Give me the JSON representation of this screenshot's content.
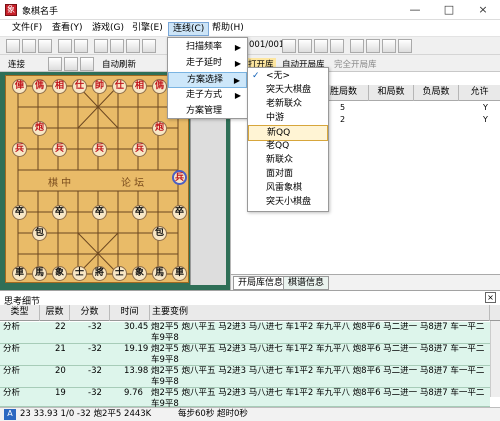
{
  "window": {
    "title": "象棋名手"
  },
  "menu": [
    "文件(F)",
    "查看(Y)",
    "游戏(G)",
    "引擎(E)",
    "连线(C)",
    "帮助(H)"
  ],
  "toolbar": {
    "page": "001/001",
    "connect_label": "连接",
    "auto_refresh": "自动刷新",
    "open_library": "打开库",
    "auto_open_library": "自动开局库",
    "full_open_library": "完全开局库"
  },
  "dropdown_main": [
    "扫描频率",
    "走子延时",
    "方案选择",
    "走子方式",
    "方案管理"
  ],
  "dropdown_sub": [
    "<无>",
    "突天大棋盘",
    "老新联众",
    "中游",
    "新QQ",
    "老QQ",
    "新联众",
    "面对面",
    "风雷象棋",
    "突天小棋盘"
  ],
  "selected_scheme": "新QQ",
  "board": {
    "center_text_left": "棋 中",
    "center_text_right": "论 坛",
    "pieces": [
      {
        "ch": "俥",
        "side": "red"
      },
      {
        "ch": "傌",
        "side": "red"
      },
      {
        "ch": "相",
        "side": "red"
      },
      {
        "ch": "仕",
        "side": "red"
      },
      {
        "ch": "帥",
        "side": "red"
      },
      {
        "ch": "仕",
        "side": "red"
      },
      {
        "ch": "相",
        "side": "red"
      },
      {
        "ch": "傌",
        "side": "red"
      },
      {
        "ch": "俥",
        "side": "red"
      },
      {
        "ch": "炮",
        "side": "red"
      },
      {
        "ch": "炮",
        "side": "red"
      },
      {
        "ch": "兵",
        "side": "red"
      },
      {
        "ch": "兵",
        "side": "red"
      },
      {
        "ch": "兵",
        "side": "red"
      },
      {
        "ch": "兵",
        "side": "red"
      },
      {
        "ch": "兵",
        "side": "red"
      },
      {
        "ch": "卒",
        "side": "black"
      },
      {
        "ch": "卒",
        "side": "black"
      },
      {
        "ch": "卒",
        "side": "black"
      },
      {
        "ch": "卒",
        "side": "black"
      },
      {
        "ch": "卒",
        "side": "black"
      },
      {
        "ch": "包",
        "side": "black"
      },
      {
        "ch": "包",
        "side": "black"
      },
      {
        "ch": "車",
        "side": "black"
      },
      {
        "ch": "馬",
        "side": "black"
      },
      {
        "ch": "象",
        "side": "black"
      },
      {
        "ch": "士",
        "side": "black"
      },
      {
        "ch": "將",
        "side": "black"
      },
      {
        "ch": "士",
        "side": "black"
      },
      {
        "ch": "象",
        "side": "black"
      },
      {
        "ch": "馬",
        "side": "black"
      },
      {
        "ch": "車",
        "side": "black"
      }
    ]
  },
  "library_table": {
    "headers": [
      "胜局数",
      "和局数",
      "负局数",
      "允许"
    ],
    "rows": [
      [
        "5",
        "",
        "",
        "Y"
      ],
      [
        "2",
        "",
        "",
        "Y"
      ]
    ],
    "tabs": [
      "开局库信息",
      "棋谱信息"
    ]
  },
  "thinking": {
    "title": "思考细节",
    "headers": [
      "类型",
      "层数",
      "分数",
      "时间",
      "主要变例"
    ],
    "rows": [
      [
        "分析",
        "22",
        "-32",
        "30.45",
        "炮2平5 炮八平五 马2进3 马八进七 车1平2 车九平八 炮8平6 马二进一 马8进7 车一平二 车9平8"
      ],
      [
        "分析",
        "21",
        "-32",
        "19.19",
        "炮2平5 炮八平五 马2进3 马八进七 车1平2 车九平八 炮8平6 马二进一 马8进7 车一平二 车9平8"
      ],
      [
        "分析",
        "20",
        "-32",
        "13.98",
        "炮2平5 炮八平五 马2进3 马八进七 车1平2 车九平八 炮8平6 马二进一 马8进7 车一平二 车9平8"
      ],
      [
        "分析",
        "19",
        "-32",
        "9.76",
        "炮2平5 炮八平五 马2进3 马八进七 车1平2 车九平八 炮8平6 马二进一 马8进7 车一平二 车9平8"
      ]
    ]
  },
  "status": {
    "left": "23 33.93 1/0 -32 炮2平5 2443K",
    "middle": "每步60秒 超时0秒"
  }
}
